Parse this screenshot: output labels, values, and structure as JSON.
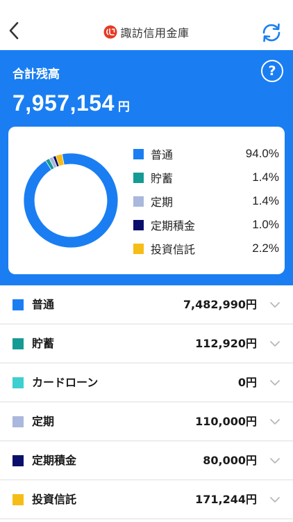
{
  "header": {
    "title": "諏訪信用金庫",
    "back_icon": "chevron-left-icon",
    "refresh_icon": "refresh-icon",
    "logo_icon": "bank-logo-icon"
  },
  "summary": {
    "title": "合計残高",
    "help_label": "?",
    "total_amount": "7,957,154",
    "total_unit": "円",
    "accent_color": "#1a7ef2"
  },
  "chart_data": {
    "type": "pie",
    "donut": true,
    "categories": [
      "普通",
      "貯蓄",
      "定期",
      "定期積金",
      "投資信託"
    ],
    "values": [
      94.0,
      1.4,
      1.4,
      1.0,
      2.2
    ],
    "labels": [
      "94.0%",
      "1.4%",
      "1.4%",
      "1.0%",
      "2.2%"
    ],
    "colors": [
      "#1a7ef2",
      "#169a94",
      "#a9b8dc",
      "#0b0f6b",
      "#f6bd16"
    ]
  },
  "accounts": [
    {
      "label": "普通",
      "amount": "7,482,990円",
      "color": "#1a7ef2"
    },
    {
      "label": "貯蓄",
      "amount": "112,920円",
      "color": "#169a94"
    },
    {
      "label": "カードローン",
      "amount": "0円",
      "color": "#3ecfd0"
    },
    {
      "label": "定期",
      "amount": "110,000円",
      "color": "#a9b8dc"
    },
    {
      "label": "定期積金",
      "amount": "80,000円",
      "color": "#0b0f6b"
    },
    {
      "label": "投資信託",
      "amount": "171,244円",
      "color": "#f6bd16"
    }
  ]
}
